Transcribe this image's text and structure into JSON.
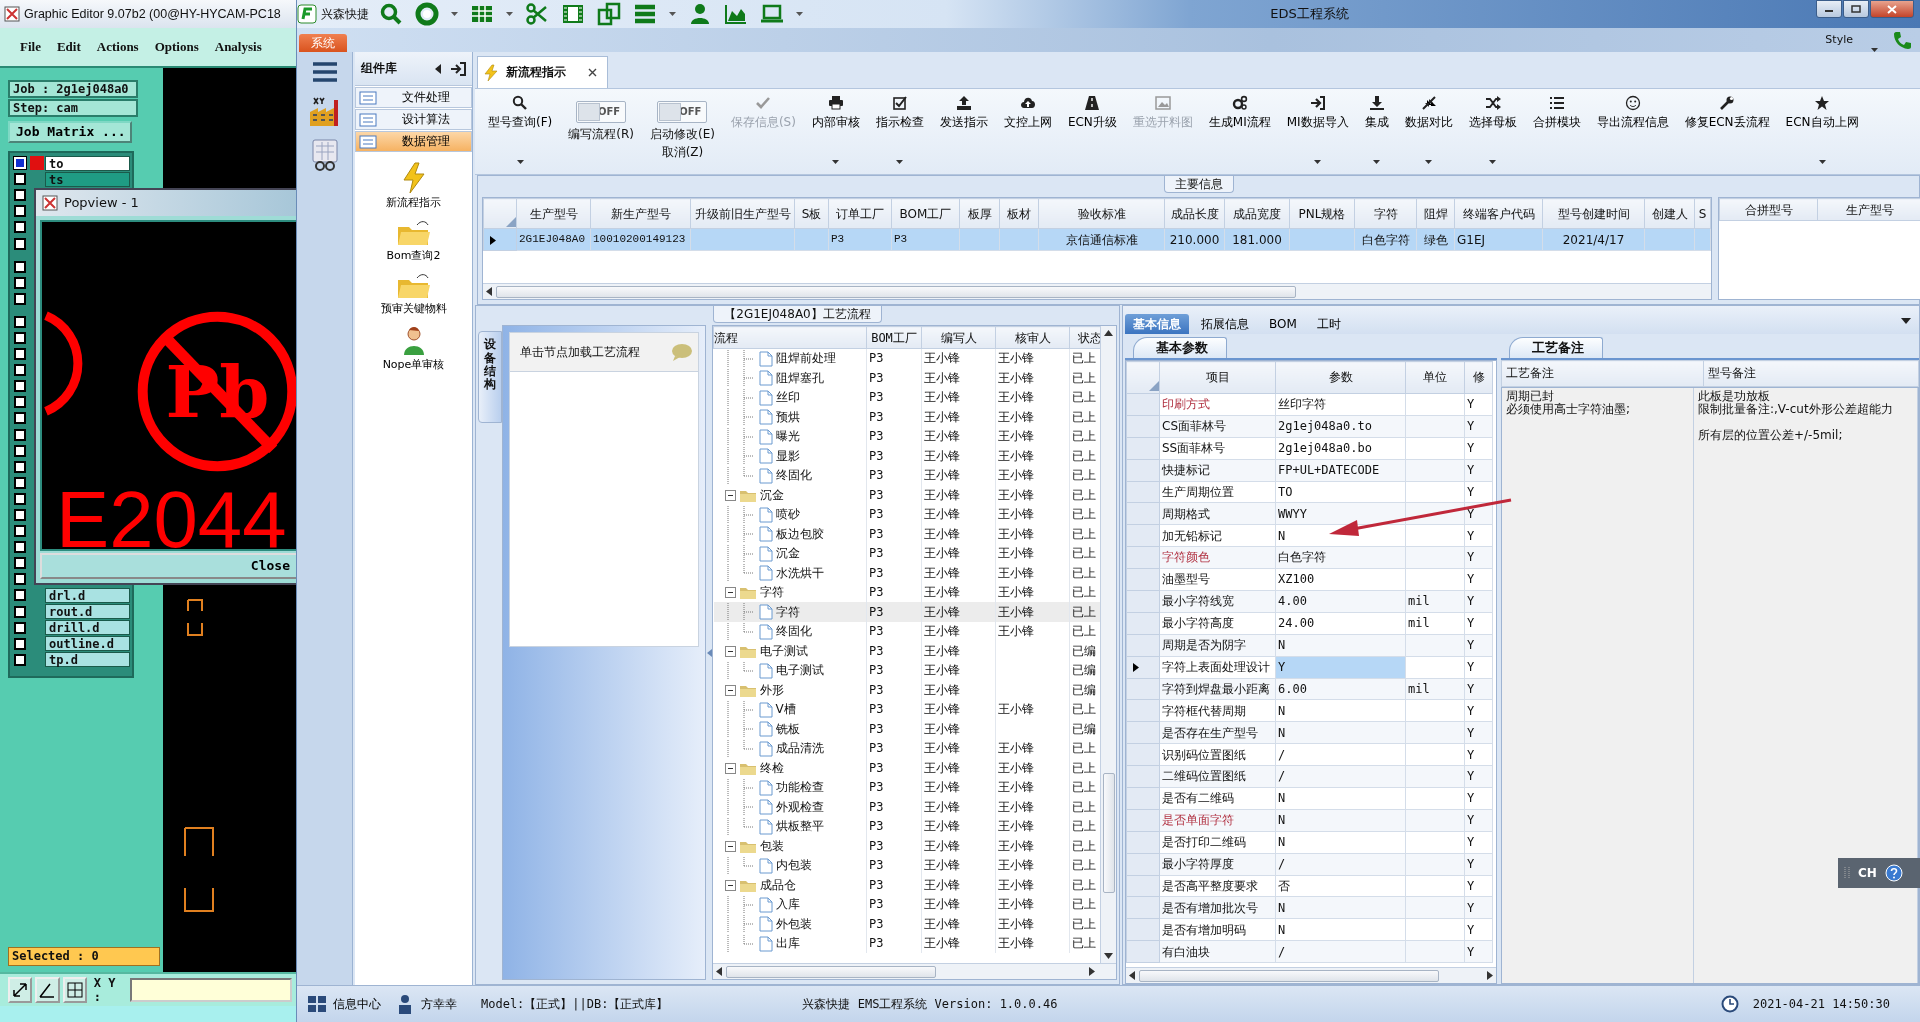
{
  "cam_window": {
    "title": "Graphic Editor 9.07b2 (00@HY-HYCAM-PC18",
    "menu": [
      "File",
      "Edit",
      "Actions",
      "Options",
      "Analysis"
    ],
    "job": "Job : 2g1ej048a0",
    "step": "Step: cam",
    "job_matrix_button": "Job Matrix ...",
    "layer_groups": [
      [
        {
          "name": "to",
          "checked": true,
          "selected": false
        },
        {
          "name": "ts",
          "checked": false,
          "selected": true
        },
        {
          "checked": false
        },
        {
          "checked": false
        },
        {
          "checked": false
        },
        {
          "checked": false
        }
      ],
      [
        {
          "checked": false
        },
        {
          "checked": false
        },
        {
          "checked": false
        }
      ],
      [
        {
          "checked": false
        },
        {
          "checked": false
        },
        {
          "checked": false
        },
        {
          "checked": false
        },
        {
          "checked": false
        },
        {
          "checked": false
        },
        {
          "checked": false
        },
        {
          "checked": false
        },
        {
          "checked": false
        },
        {
          "checked": false
        },
        {
          "checked": false
        },
        {
          "checked": false
        },
        {
          "checked": false
        },
        {
          "checked": false
        },
        {
          "checked": false
        },
        {
          "checked": false
        },
        {
          "checked": false
        },
        {
          "name": "drl.d",
          "checked": false,
          "selected": false
        },
        {
          "name": "rout.d",
          "checked": false,
          "selected": false
        },
        {
          "name": "drill.d",
          "checked": false,
          "selected": false
        },
        {
          "name": "outline.d",
          "checked": false,
          "selected": false
        },
        {
          "name": "tp.d",
          "checked": false,
          "selected": false
        }
      ]
    ],
    "selected_count": "Selected : 0",
    "xy_label": "X Y :"
  },
  "popview": {
    "title": "Popview - 1",
    "symbol_text": "Pb",
    "marking_text": "E2044",
    "close_button": "Close"
  },
  "eds": {
    "quick_title": "兴森快捷",
    "title": "EDS工程系统",
    "menu_tab": "系统",
    "style_menu": "Style",
    "components": {
      "title": "组件库",
      "categories": [
        {
          "label": "文件处理",
          "selected": false
        },
        {
          "label": "设计算法",
          "selected": false
        },
        {
          "label": "数据管理",
          "selected": true
        }
      ],
      "tools": [
        "新流程指示",
        "Bom查询2",
        "预审关键物料",
        "Nope单审核"
      ]
    },
    "doc_tab": "新流程指示",
    "toolbar": [
      {
        "kind": "button",
        "label": "型号查询(F)",
        "dropdown": true,
        "disabled": false
      },
      {
        "kind": "toggle",
        "toggle_text": "OFF",
        "on": false,
        "label": "编写流程(R)"
      },
      {
        "kind": "toggle",
        "toggle_text": "OFF",
        "on": false,
        "label": "启动修改(E)",
        "label_2": "取消(Z)"
      },
      {
        "kind": "button",
        "label": "保存信息(S)",
        "dropdown": false,
        "disabled": true
      },
      {
        "kind": "button",
        "label": "内部审核",
        "dropdown": true,
        "disabled": false
      },
      {
        "kind": "button",
        "label": "指示检查",
        "dropdown": true,
        "disabled": false
      },
      {
        "kind": "button",
        "label": "发送指示",
        "dropdown": false,
        "disabled": false
      },
      {
        "kind": "button",
        "label": "文控上网",
        "dropdown": false,
        "disabled": false
      },
      {
        "kind": "button",
        "label": "ECN升级",
        "dropdown": false,
        "disabled": false
      },
      {
        "kind": "button",
        "label": "重选开料图",
        "dropdown": false,
        "disabled": true
      },
      {
        "kind": "button",
        "label": "生成MI流程",
        "dropdown": false,
        "disabled": false
      },
      {
        "kind": "button",
        "label": "MI数据导入",
        "dropdown": true,
        "disabled": false
      },
      {
        "kind": "button",
        "label": "集成",
        "dropdown": true,
        "disabled": false
      },
      {
        "kind": "button",
        "label": "数据对比",
        "dropdown": true,
        "disabled": false
      },
      {
        "kind": "button",
        "label": "选择母板",
        "dropdown": true,
        "disabled": false
      },
      {
        "kind": "button",
        "label": "合拼模块",
        "dropdown": false,
        "disabled": false
      },
      {
        "kind": "button",
        "label": "导出流程信息",
        "dropdown": false,
        "disabled": false
      },
      {
        "kind": "button",
        "label": "修复ECN丢流程",
        "dropdown": false,
        "disabled": false
      },
      {
        "kind": "button",
        "label": "ECN自动上网",
        "dropdown": true,
        "disabled": false
      }
    ],
    "main_info": {
      "title": "主要信息",
      "columns": [
        "生产型号",
        "新生产型号",
        "升级前旧生产型号",
        "S板",
        "订单工厂",
        "BOM工厂",
        "板厚",
        "板材",
        "验收标准",
        "成品长度",
        "成品宽度",
        "PNL规格",
        "字符",
        "阻焊",
        "终端客户代码",
        "型号创建时间",
        "创建人",
        "S"
      ],
      "rows": [
        {
          "selected": true,
          "cells": [
            "2G1EJ048A0",
            "10010200149123",
            null,
            null,
            "P3",
            "P3",
            null,
            null,
            "京信通信标准",
            "210.000",
            "181.000",
            null,
            "白色字符",
            "绿色",
            "G1EJ",
            "2021/4/17",
            null,
            null
          ]
        }
      ],
      "side_columns": [
        "合拼型号",
        "生产型号"
      ]
    },
    "process": {
      "title": "【2G1EJ048A0】工艺流程",
      "side_tab": "设备结构",
      "hint": "单击节点加载工艺流程",
      "columns": [
        "流程",
        "BOM工厂",
        "编写人",
        "核审人",
        "状态"
      ],
      "rows": [
        {
          "expanded": true,
          "children": [
            {
              "label": "阻焊前处理",
              "bom": "P3",
              "writer": "王小锋",
              "reviewer": "王小锋",
              "status": "已上",
              "selected": false
            },
            {
              "label": "阻焊塞孔",
              "bom": "P3",
              "writer": "王小锋",
              "reviewer": "王小锋",
              "status": "已上",
              "selected": false
            },
            {
              "label": "丝印",
              "bom": "P3",
              "writer": "王小锋",
              "reviewer": "王小锋",
              "status": "已上",
              "selected": false
            },
            {
              "label": "预烘",
              "bom": "P3",
              "writer": "王小锋",
              "reviewer": "王小锋",
              "status": "已上",
              "selected": false
            },
            {
              "label": "曝光",
              "bom": "P3",
              "writer": "王小锋",
              "reviewer": "王小锋",
              "status": "已上",
              "selected": false
            },
            {
              "label": "显影",
              "bom": "P3",
              "writer": "王小锋",
              "reviewer": "王小锋",
              "status": "已上",
              "selected": false
            },
            {
              "label": "终固化",
              "bom": "P3",
              "writer": "王小锋",
              "reviewer": "王小锋",
              "status": "已上",
              "selected": false
            }
          ]
        },
        {
          "label": "沉金",
          "bom": "P3",
          "writer": "王小锋",
          "reviewer": "王小锋",
          "status": "已上",
          "selected": false,
          "expanded": true,
          "children": [
            {
              "label": "喷砂",
              "bom": "P3",
              "writer": "王小锋",
              "reviewer": "王小锋",
              "status": "已上",
              "selected": false
            },
            {
              "label": "板边包胶",
              "bom": "P3",
              "writer": "王小锋",
              "reviewer": "王小锋",
              "status": "已上",
              "selected": false
            },
            {
              "label": "沉金",
              "bom": "P3",
              "writer": "王小锋",
              "reviewer": "王小锋",
              "status": "已上",
              "selected": false
            },
            {
              "label": "水洗烘干",
              "bom": "P3",
              "writer": "王小锋",
              "reviewer": "王小锋",
              "status": "已上",
              "selected": false
            }
          ]
        },
        {
          "label": "字符",
          "bom": "P3",
          "writer": "王小锋",
          "reviewer": "王小锋",
          "status": "已上",
          "selected": false,
          "expanded": true,
          "children": [
            {
              "label": "字符",
              "bom": "P3",
              "writer": "王小锋",
              "reviewer": "王小锋",
              "status": "已上",
              "selected": true
            },
            {
              "label": "终固化",
              "bom": "P3",
              "writer": "王小锋",
              "reviewer": "王小锋",
              "status": "已上",
              "selected": false
            }
          ]
        },
        {
          "label": "电子测试",
          "bom": "P3",
          "writer": "王小锋",
          "status": "已编",
          "selected": false,
          "expanded": true,
          "children": [
            {
              "label": "电子测试",
              "bom": "P3",
              "writer": "王小锋",
              "status": "已编",
              "selected": false
            }
          ]
        },
        {
          "label": "外形",
          "bom": "P3",
          "writer": "王小锋",
          "status": "已编",
          "selected": false,
          "expanded": true,
          "children": [
            {
              "label": "V槽",
              "bom": "P3",
              "writer": "王小锋",
              "reviewer": "王小锋",
              "status": "已上",
              "selected": false
            },
            {
              "label": "铣板",
              "bom": "P3",
              "writer": "王小锋",
              "status": "已编",
              "selected": false
            },
            {
              "label": "成品清洗",
              "bom": "P3",
              "writer": "王小锋",
              "reviewer": "王小锋",
              "status": "已上",
              "selected": false
            }
          ]
        },
        {
          "label": "终检",
          "bom": "P3",
          "writer": "王小锋",
          "reviewer": "王小锋",
          "status": "已上",
          "selected": false,
          "expanded": true,
          "children": [
            {
              "label": "功能检查",
              "bom": "P3",
              "writer": "王小锋",
              "reviewer": "王小锋",
              "status": "已上",
              "selected": false
            },
            {
              "label": "外观检查",
              "bom": "P3",
              "writer": "王小锋",
              "reviewer": "王小锋",
              "status": "已上",
              "selected": false
            },
            {
              "label": "烘板整平",
              "bom": "P3",
              "writer": "王小锋",
              "reviewer": "王小锋",
              "status": "已上",
              "selected": false
            }
          ]
        },
        {
          "label": "包装",
          "bom": "P3",
          "writer": "王小锋",
          "reviewer": "王小锋",
          "status": "已上",
          "selected": false,
          "expanded": true,
          "children": [
            {
              "label": "内包装",
              "bom": "P3",
              "writer": "王小锋",
              "reviewer": "王小锋",
              "status": "已上",
              "selected": false
            }
          ]
        },
        {
          "label": "成品仓",
          "bom": "P3",
          "writer": "王小锋",
          "reviewer": "王小锋",
          "status": "已上",
          "selected": false,
          "expanded": true,
          "children": [
            {
              "label": "入库",
              "bom": "P3",
              "writer": "王小锋",
              "reviewer": "王小锋",
              "status": "已上",
              "selected": false
            },
            {
              "label": "外包装",
              "bom": "P3",
              "writer": "王小锋",
              "reviewer": "王小锋",
              "status": "已上",
              "selected": false
            },
            {
              "label": "出库",
              "bom": "P3",
              "writer": "王小锋",
              "reviewer": "王小锋",
              "status": "已上",
              "selected": false
            }
          ]
        }
      ]
    },
    "detail_tabs": [
      {
        "label": "基本信息",
        "selected": true
      },
      {
        "label": "拓展信息",
        "selected": false
      },
      {
        "label": "BOM",
        "selected": false
      },
      {
        "label": "工时",
        "selected": false
      }
    ],
    "params": {
      "subtab": "基本参数",
      "columns": [
        "项目",
        "参数",
        "单位",
        "修"
      ],
      "rows": [
        {
          "item": "印刷方式",
          "value": "丝印字符",
          "flag": "Y",
          "highlight": true,
          "selected": false
        },
        {
          "item": "CS面菲林号",
          "value": "2g1ej048a0.to",
          "flag": "Y",
          "highlight": false,
          "selected": false
        },
        {
          "item": "SS面菲林号",
          "value": "2g1ej048a0.bo",
          "flag": "Y",
          "highlight": false,
          "selected": false
        },
        {
          "item": "快捷标记",
          "value": "FP+UL+DATECODE",
          "flag": "Y",
          "highlight": false,
          "selected": false
        },
        {
          "item": "生产周期位置",
          "value": "TO",
          "flag": "Y",
          "highlight": false,
          "selected": false
        },
        {
          "item": "周期格式",
          "value": "WWYY",
          "flag": "Y",
          "highlight": false,
          "selected": false
        },
        {
          "item": "加无铅标记",
          "value": "N",
          "flag": "Y",
          "highlight": false,
          "selected": false
        },
        {
          "item": "字符颜色",
          "value": "白色字符",
          "flag": "Y",
          "highlight": true,
          "selected": false
        },
        {
          "item": "油墨型号",
          "value": "XZ100",
          "flag": "Y",
          "highlight": false,
          "selected": false
        },
        {
          "item": "最小字符线宽",
          "value": "4.00",
          "unit": "mil",
          "flag": "Y",
          "highlight": false,
          "selected": false
        },
        {
          "item": "最小字符高度",
          "value": "24.00",
          "unit": "mil",
          "flag": "Y",
          "highlight": false,
          "selected": false
        },
        {
          "item": "周期是否为阴字",
          "value": "N",
          "flag": "Y",
          "highlight": false,
          "selected": false
        },
        {
          "item": "字符上表面处理设计",
          "value": "Y",
          "flag": "Y",
          "highlight": false,
          "selected": true
        },
        {
          "item": "字符到焊盘最小距离",
          "value": "6.00",
          "unit": "mil",
          "flag": "Y",
          "highlight": false,
          "selected": false
        },
        {
          "item": "字符框代替周期",
          "value": "N",
          "flag": "Y",
          "highlight": false,
          "selected": false
        },
        {
          "item": "是否存在生产型号",
          "value": "N",
          "flag": "Y",
          "highlight": false,
          "selected": false
        },
        {
          "item": "识别码位置图纸",
          "value": "/",
          "flag": "Y",
          "highlight": false,
          "selected": false
        },
        {
          "item": "二维码位置图纸",
          "value": "/",
          "flag": "Y",
          "highlight": false,
          "selected": false
        },
        {
          "item": "是否有二维码",
          "value": "N",
          "flag": "Y",
          "highlight": false,
          "selected": false
        },
        {
          "item": "是否单面字符",
          "value": "N",
          "flag": "Y",
          "highlight": true,
          "selected": false
        },
        {
          "item": "是否打印二维码",
          "value": "N",
          "flag": "Y",
          "highlight": false,
          "selected": false
        },
        {
          "item": "最小字符厚度",
          "value": "/",
          "flag": "Y",
          "highlight": false,
          "selected": false
        },
        {
          "item": "是否高平整度要求",
          "value": "否",
          "flag": "Y",
          "highlight": false,
          "selected": false
        },
        {
          "item": "是否有增加批次号",
          "value": "N",
          "flag": "Y",
          "highlight": false,
          "selected": false
        },
        {
          "item": "是否有增加明码",
          "value": "N",
          "flag": "Y",
          "highlight": false,
          "selected": false
        },
        {
          "item": "有白油块",
          "value": "/",
          "flag": "Y",
          "highlight": false,
          "selected": false
        }
      ]
    },
    "notes": {
      "subtab": "工艺备注",
      "columns": [
        "工艺备注",
        "型号备注"
      ],
      "process_note": [
        [
          "周期已封",
          "必须使用高士字符油墨;"
        ]
      ],
      "model_note": [
        [
          "此板是功放板",
          "限制批量备注:,V-cut外形公差超能力"
        ],
        [
          "所有层的位置公差+/-5mil;"
        ]
      ]
    },
    "status": {
      "items": [
        "信息中心",
        "方幸幸"
      ],
      "model": "Model:【正式】||DB:【正式库】",
      "version": "兴森快捷 EMS工程系统 Version: 1.0.0.46",
      "datetime": "2021-04-21 14:50:30"
    }
  },
  "language_bar": {
    "label": "CH"
  }
}
